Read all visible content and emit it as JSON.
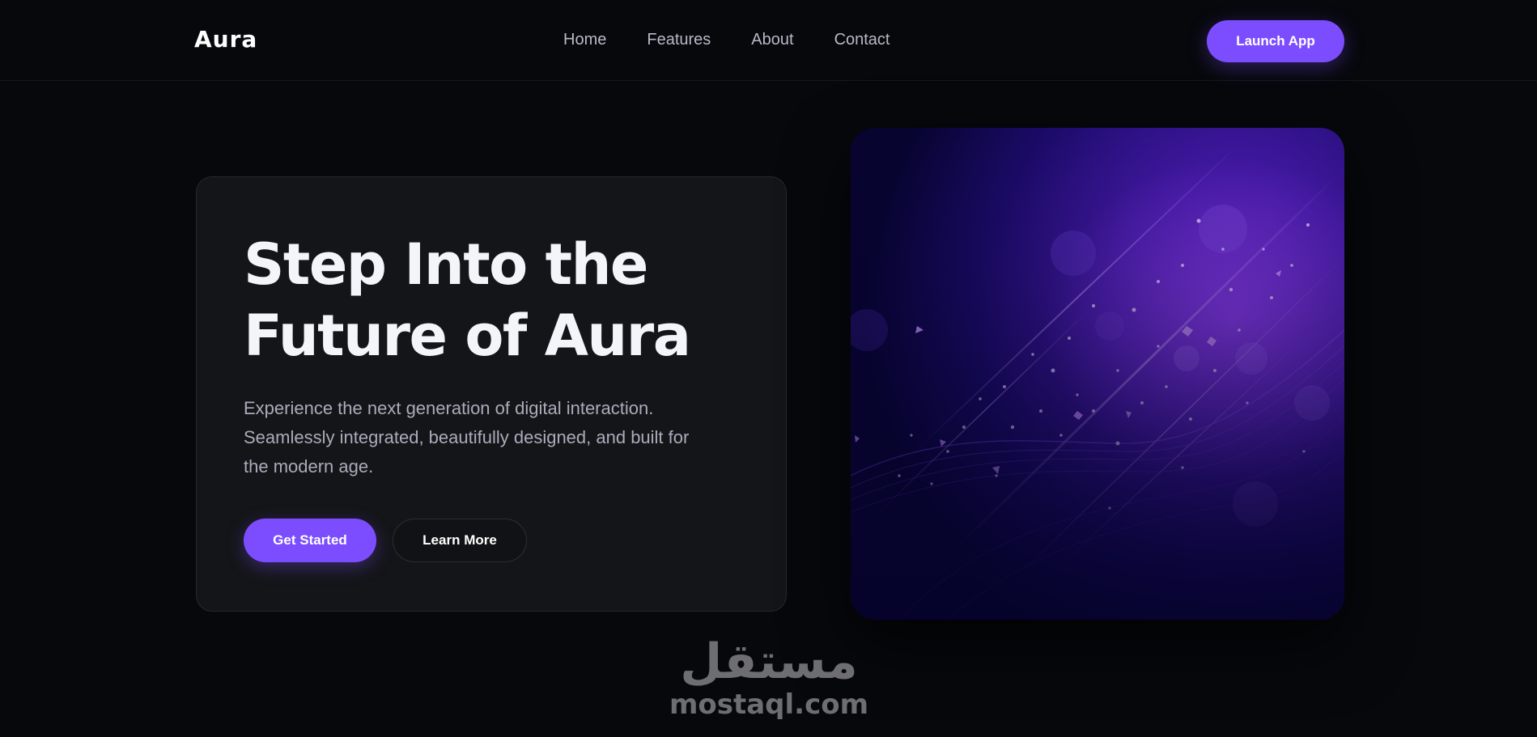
{
  "nav": {
    "logo": "Aura",
    "links": [
      "Home",
      "Features",
      "About",
      "Contact"
    ],
    "launch_label": "Launch App"
  },
  "hero": {
    "title_line1": "Step Into the",
    "title_line2": "Future of Aura",
    "subtitle_line1": "Experience the next generation of digital interaction.",
    "subtitle_line2": "Seamlessly integrated, beautifully designed, and built for",
    "subtitle_line3": "the modern age.",
    "primary_cta": "Get Started",
    "secondary_cta": "Learn More"
  },
  "watermark": {
    "arabic": "مستقل",
    "latin": "mostaql.com"
  },
  "colors": {
    "accent": "#7c4dff",
    "background": "#07080c",
    "card": "#141518",
    "muted_text": "#a9adbb"
  }
}
